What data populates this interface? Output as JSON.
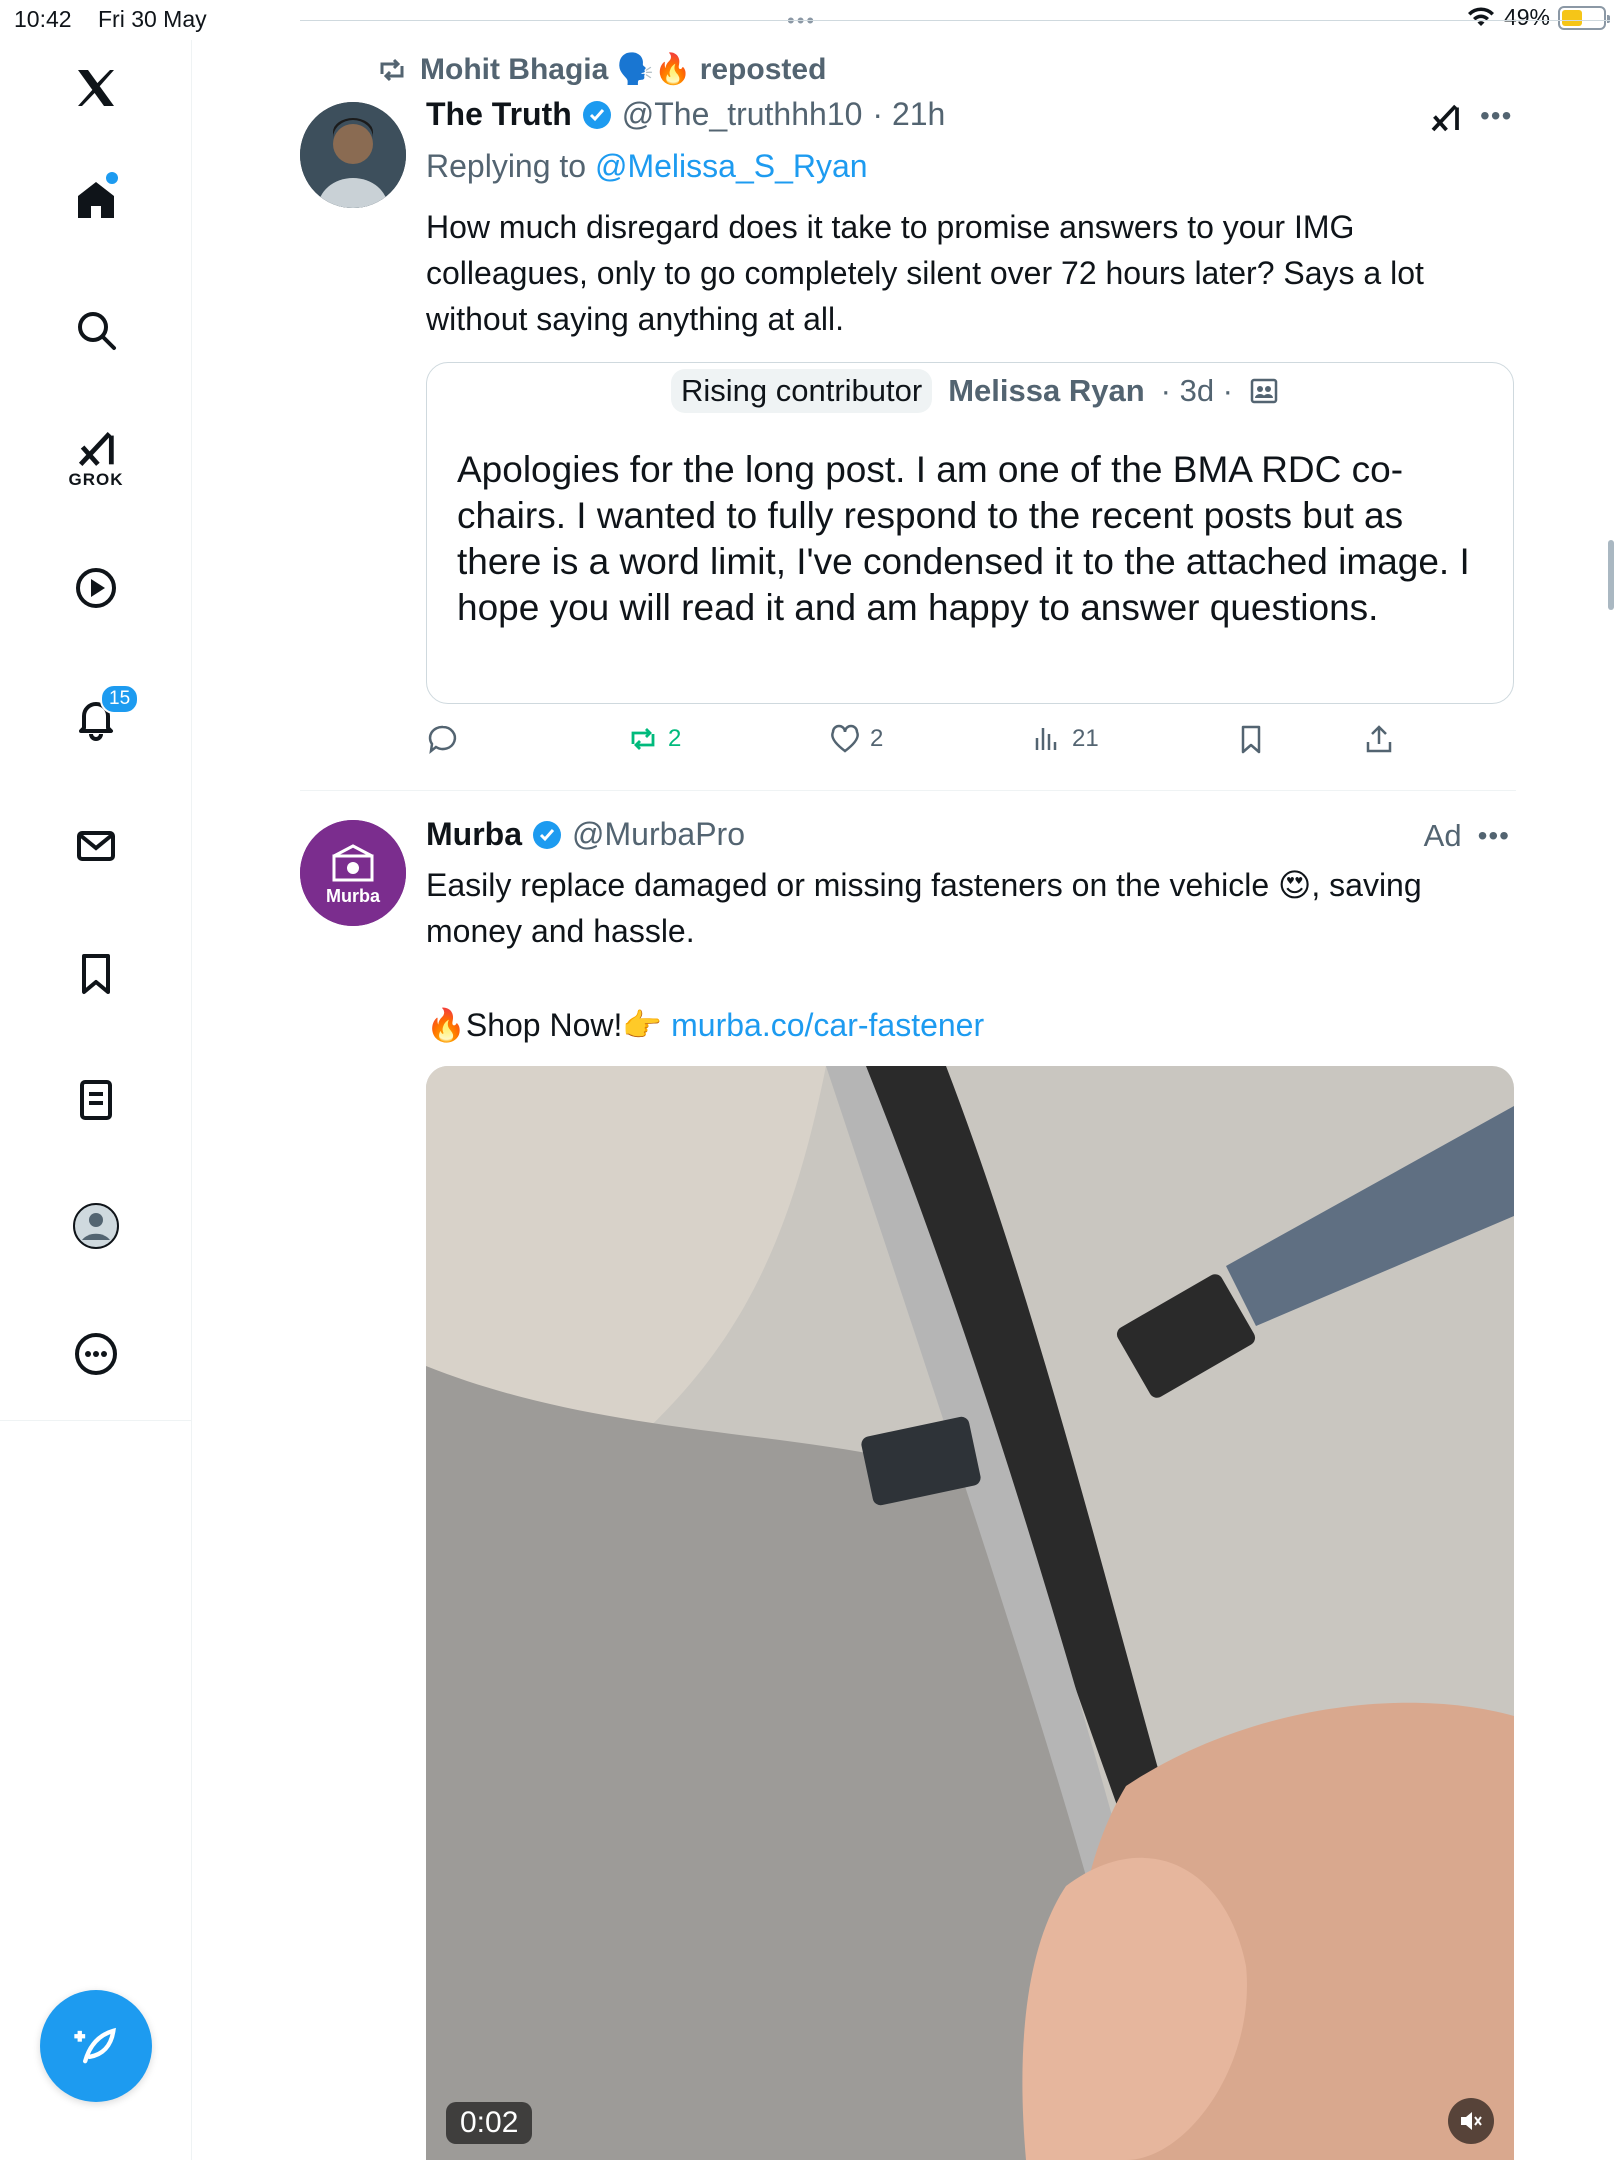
{
  "status_bar": {
    "time": "10:42",
    "date": "Fri 30 May",
    "battery": "49%",
    "battery_level": 0.49
  },
  "sidebar": {
    "grok_label": "GROK",
    "notifications_badge": "15",
    "items": [
      "x-logo",
      "home",
      "search",
      "grok",
      "video",
      "notifications",
      "messages",
      "bookmarks",
      "lists",
      "profile",
      "more"
    ]
  },
  "post1": {
    "repost_by": "Mohit Bhagia 🗣️🔥 reposted",
    "author_name": "The Truth",
    "author_handle": "@The_truthhh10",
    "time": "· 21h",
    "replying_prefix": "Replying to",
    "replying_handle": "@Melissa_S_Ryan",
    "text": "How much disregard does it take to promise answers to your IMG colleagues, only to go completely silent over 72 hours later? Says a lot without saying anything at all.",
    "quote": {
      "pill": "Rising contributor",
      "author": "Melissa Ryan",
      "time": "· 3d ·",
      "text": "Apologies for the long post. I am one of the BMA RDC co-chairs. I wanted to fully respond to the recent posts but as there is a word limit, I've condensed it to the attached image. I hope you will read it and am happy to answer questions."
    },
    "actions": {
      "reposts": "2",
      "likes": "2",
      "views": "21"
    }
  },
  "post2": {
    "author_name": "Murba",
    "author_handle": "@MurbaPro",
    "ad_label": "Ad",
    "avatar_text": "Murba",
    "text": "Easily replace damaged or missing fasteners on the vehicle 😍, saving money and hassle.",
    "cta_text": "🔥Shop Now!👉",
    "cta_link": "murba.co/car-fastener",
    "video_time": "0:02"
  },
  "colors": {
    "accent": "#1d9bf0",
    "repost_green": "#00ba7c",
    "murba_purple": "#7b2d8e"
  }
}
